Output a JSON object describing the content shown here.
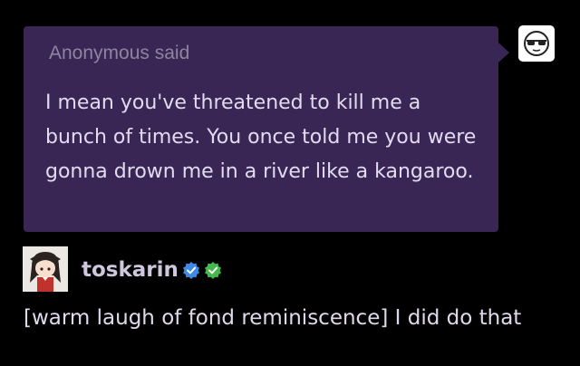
{
  "ask": {
    "asker_name": "Anonymous",
    "asker_verb": "said",
    "question": "I mean you've threatened to kill me a bunch of times. You once told me you were gonna drown me in a river like a kangaroo."
  },
  "reply": {
    "username": "toskarin",
    "answer": "[warm laugh of fond reminiscence] I did do that"
  },
  "colors": {
    "bubble": "#3a2654",
    "badge_blue": "#3d89e3",
    "badge_green": "#45b94b"
  },
  "icons": {
    "anon_avatar": "anonymous-sunglasses-icon",
    "verified_badge": "verified-check-icon",
    "second_badge": "green-check-icon"
  }
}
